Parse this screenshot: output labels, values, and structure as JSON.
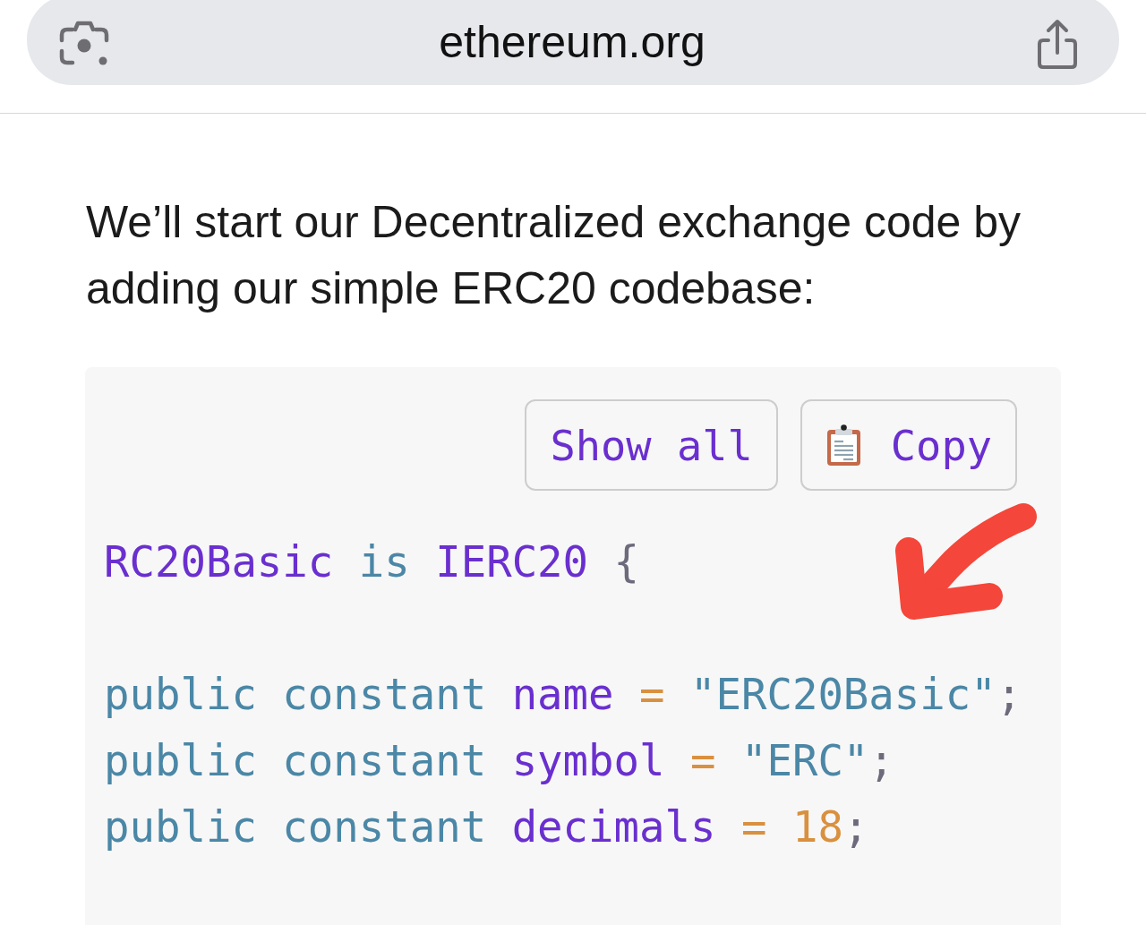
{
  "address_bar": {
    "url": "ethereum.org"
  },
  "article": {
    "paragraph": "We’ll start our Decentralized exchange code by adding our simple ERC20 codebase:"
  },
  "code_block": {
    "buttons": [
      {
        "kind": "show_all",
        "label": "Show all"
      },
      {
        "kind": "copy",
        "label": "Copy"
      }
    ],
    "lines": [
      {
        "kind": "code",
        "tokens": [
          {
            "kind": "identifier",
            "text": "RC20Basic"
          },
          {
            "kind": "keyword",
            "text": "is"
          },
          {
            "kind": "identifier",
            "text": "IERC20"
          },
          {
            "kind": "punctuation",
            "text": "{"
          }
        ]
      },
      {
        "kind": "blank"
      },
      {
        "kind": "code",
        "tokens": [
          {
            "kind": "keyword",
            "text": "public"
          },
          {
            "kind": "keyword",
            "text": "constant"
          },
          {
            "kind": "identifier",
            "text": "name"
          },
          {
            "kind": "operator",
            "text": "="
          },
          {
            "kind": "string",
            "text": "\"ERC20Basic\""
          },
          {
            "kind": "terminator",
            "text": ";"
          }
        ]
      },
      {
        "kind": "code",
        "tokens": [
          {
            "kind": "keyword",
            "text": "public"
          },
          {
            "kind": "keyword",
            "text": "constant"
          },
          {
            "kind": "identifier",
            "text": "symbol"
          },
          {
            "kind": "operator",
            "text": "="
          },
          {
            "kind": "string",
            "text": "\"ERC\""
          },
          {
            "kind": "terminator",
            "text": ";"
          }
        ]
      },
      {
        "kind": "code",
        "tokens": [
          {
            "kind": "keyword",
            "text": "public"
          },
          {
            "kind": "keyword",
            "text": "constant"
          },
          {
            "kind": "identifier",
            "text": "decimals"
          },
          {
            "kind": "operator",
            "text": "="
          },
          {
            "kind": "number",
            "text": "18"
          },
          {
            "kind": "terminator",
            "text": ";"
          }
        ]
      }
    ]
  }
}
